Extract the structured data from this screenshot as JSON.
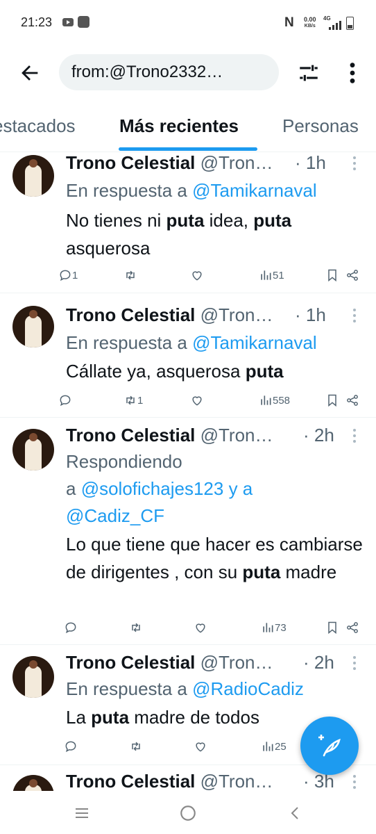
{
  "status_bar": {
    "time": "21:23",
    "net_speed_value": "0.00",
    "net_speed_unit": "KB/s",
    "network": "4G",
    "icons": [
      "youtube-icon",
      "app-notification-icon",
      "nfc-icon",
      "signal-icon",
      "battery-icon"
    ]
  },
  "search": {
    "query": "from:@Trono2332…"
  },
  "tabs": [
    {
      "label": "estacados",
      "active": false
    },
    {
      "label": "Más recientes",
      "active": true
    },
    {
      "label": "Personas",
      "active": false
    }
  ],
  "accent_color": "#1d9bf0",
  "tweets": [
    {
      "name": "Trono Celestial",
      "handle": "@Tron…",
      "time": "· 1h",
      "reply_prefix": "En respuesta a",
      "reply_line2_prefix": "",
      "mentions": [
        "@Tamikarnaval"
      ],
      "mention_joiner": "",
      "text_segments": [
        {
          "text": "No tienes ni ",
          "bold": false
        },
        {
          "text": "puta",
          "bold": true
        },
        {
          "text": " idea, ",
          "bold": false
        },
        {
          "text": "puta",
          "bold": true
        },
        {
          "text": " asquerosa",
          "bold": false
        }
      ],
      "replies": "1",
      "retweets": "",
      "likes": "",
      "views": "51"
    },
    {
      "name": "Trono Celestial",
      "handle": "@Tron…",
      "time": "· 1h",
      "reply_prefix": "En respuesta a",
      "reply_line2_prefix": "",
      "mentions": [
        "@Tamikarnaval"
      ],
      "mention_joiner": "",
      "text_segments": [
        {
          "text": "Cállate ya, asquerosa ",
          "bold": false
        },
        {
          "text": "puta",
          "bold": true
        }
      ],
      "replies": "",
      "retweets": "1",
      "likes": "",
      "views": "558"
    },
    {
      "name": "Trono Celestial",
      "handle": "@Tron…",
      "time": "· 2h",
      "reply_prefix": "Respondiendo",
      "reply_line2_prefix": "a",
      "mentions": [
        "@solofichajes123",
        "@Cadiz_CF"
      ],
      "mention_joiner": "y a",
      "text_segments": [
        {
          "text": "Lo que tiene que hacer es cambiarse de dirigentes , con su ",
          "bold": false
        },
        {
          "text": "puta",
          "bold": true
        },
        {
          "text": " madre",
          "bold": false
        }
      ],
      "replies": "",
      "retweets": "",
      "likes": "",
      "views": "73"
    },
    {
      "name": "Trono Celestial",
      "handle": "@Tron…",
      "time": "· 2h",
      "reply_prefix": "En respuesta a",
      "reply_line2_prefix": "",
      "mentions": [
        "@RadioCadiz"
      ],
      "mention_joiner": "",
      "text_segments": [
        {
          "text": "La ",
          "bold": false
        },
        {
          "text": "puta",
          "bold": true
        },
        {
          "text": " madre de todos",
          "bold": false
        }
      ],
      "replies": "",
      "retweets": "",
      "likes": "",
      "views": "25"
    },
    {
      "name": "Trono Celestial",
      "handle": "@Tron…",
      "time": "· 3h"
    }
  ]
}
